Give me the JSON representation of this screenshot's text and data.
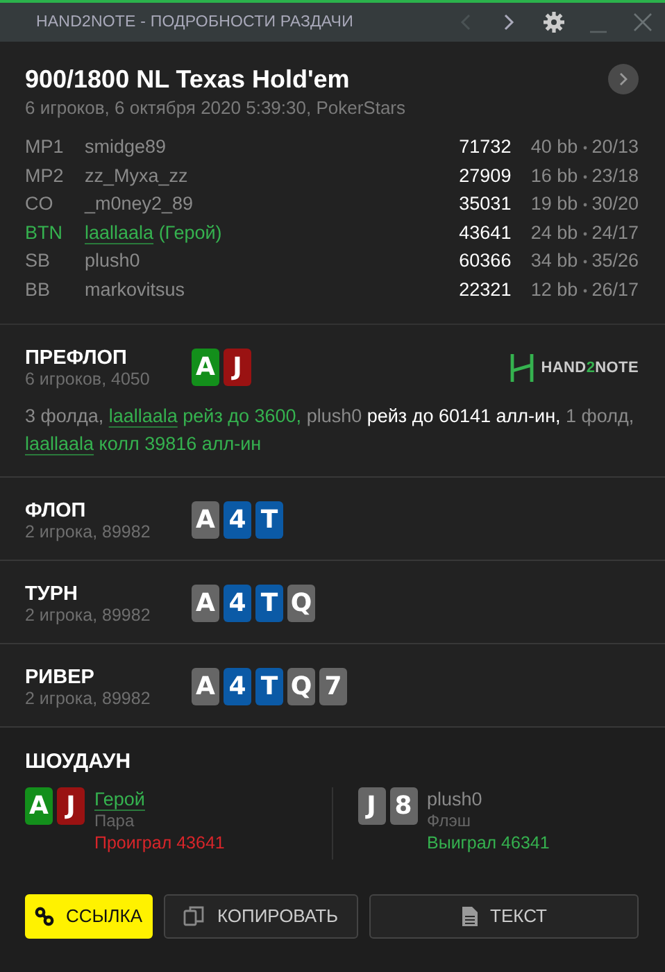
{
  "window": {
    "title": "HAND2NOTE - ПОДРОБНОСТИ РАЗДАЧИ",
    "prev_disabled": true,
    "next_disabled": false
  },
  "header": {
    "title": "900/1800 NL Texas Hold'em",
    "subtitle": "6 игроков, 6 октября 2020 5:39:30, PokerStars"
  },
  "players": [
    {
      "position": "MP1",
      "name": "smidge89",
      "hero": false,
      "stack": "71732",
      "bb": "40 bb",
      "stats": "20/13"
    },
    {
      "position": "MP2",
      "name": "zz_Myxa_zz",
      "hero": false,
      "stack": "27909",
      "bb": "16 bb",
      "stats": "23/18"
    },
    {
      "position": "CO",
      "name": "_m0ney2_89",
      "hero": false,
      "stack": "35031",
      "bb": "19 bb",
      "stats": "30/20"
    },
    {
      "position": "BTN",
      "name": "laallaala",
      "hero": true,
      "hero_label": "(Герой)",
      "stack": "43641",
      "bb": "24 bb",
      "stats": "24/17"
    },
    {
      "position": "SB",
      "name": "plush0",
      "hero": false,
      "stack": "60366",
      "bb": "34 bb",
      "stats": "35/26"
    },
    {
      "position": "BB",
      "name": "markovitsus",
      "hero": false,
      "stack": "22321",
      "bb": "12 bb",
      "stats": "26/17"
    }
  ],
  "streets": [
    {
      "name": "ПРЕФЛОП",
      "info": "6 игроков, 4050",
      "cards": [
        {
          "rank": "A",
          "color": "#138f1b"
        },
        {
          "rank": "J",
          "color": "#9a1212"
        }
      ],
      "logo": [
        {
          "text": "HAND",
          "accent": false
        },
        {
          "text": "2",
          "accent": true
        },
        {
          "text": "NOTE",
          "accent": false
        }
      ],
      "actions": [
        {
          "kind": "muted",
          "text": "3 фолда, "
        },
        {
          "kind": "link",
          "text": "laallaala"
        },
        {
          "kind": "hero",
          "text": " рейз до 3600, "
        },
        {
          "kind": "muted",
          "text": "plush0"
        },
        {
          "kind": "bright",
          "text": " рейз до 60141 алл-ин, "
        },
        {
          "kind": "muted",
          "text": "1 фолд, "
        },
        {
          "kind": "link",
          "text": "laallaala"
        },
        {
          "kind": "hero",
          "text": " колл 39816 алл-ин"
        }
      ]
    },
    {
      "name": "ФЛОП",
      "info": "2 игрока, 89982",
      "cards": [
        {
          "rank": "A",
          "color": "#666666"
        },
        {
          "rank": "4",
          "color": "#0b5aa6"
        },
        {
          "rank": "T",
          "color": "#0b5aa6"
        }
      ]
    },
    {
      "name": "ТУРН",
      "info": "2 игрока, 89982",
      "cards": [
        {
          "rank": "A",
          "color": "#666666"
        },
        {
          "rank": "4",
          "color": "#0b5aa6"
        },
        {
          "rank": "T",
          "color": "#0b5aa6"
        },
        {
          "rank": "Q",
          "color": "#666666"
        }
      ]
    },
    {
      "name": "РИВЕР",
      "info": "2 игрока, 89982",
      "cards": [
        {
          "rank": "A",
          "color": "#666666"
        },
        {
          "rank": "4",
          "color": "#0b5aa6"
        },
        {
          "rank": "T",
          "color": "#0b5aa6"
        },
        {
          "rank": "Q",
          "color": "#666666"
        },
        {
          "rank": "7",
          "color": "#666666"
        }
      ]
    }
  ],
  "showdown": {
    "title": "ШОУДАУН",
    "players": [
      {
        "name": "Герой",
        "hero": true,
        "hand": "Пара",
        "result": "Проиграл 43641",
        "won": false,
        "cards": [
          {
            "rank": "A",
            "color": "#138f1b"
          },
          {
            "rank": "J",
            "color": "#9a1212"
          }
        ]
      },
      {
        "name": "plush0",
        "hero": false,
        "hand": "Флэш",
        "result": "Выиграл 46341",
        "won": true,
        "cards": [
          {
            "rank": "J",
            "color": "#666666"
          },
          {
            "rank": "8",
            "color": "#666666"
          }
        ]
      }
    ]
  },
  "buttons": [
    {
      "label": "ССЫЛКА",
      "kind": "link",
      "primary": true
    },
    {
      "label": "КОПИРОВАТЬ",
      "kind": "copy",
      "primary": false
    },
    {
      "label": "ТЕКСТ",
      "kind": "document",
      "primary": false
    }
  ]
}
